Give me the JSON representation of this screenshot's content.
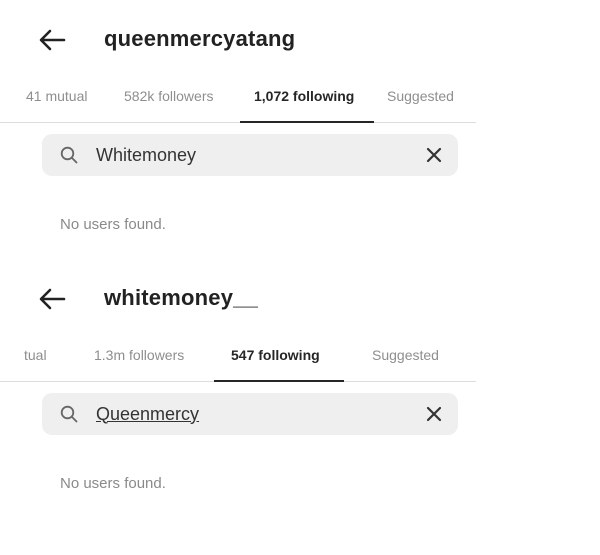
{
  "panels": [
    {
      "username": "queenmercyatang",
      "tabs": [
        {
          "label": "41 mutual",
          "active": false
        },
        {
          "label": "582k followers",
          "active": false
        },
        {
          "label": "1,072 following",
          "active": true
        },
        {
          "label": "Suggested",
          "active": false
        }
      ],
      "search": {
        "value": "Whitemoney",
        "placeholder": "Search"
      },
      "empty_message": "No users found."
    },
    {
      "username": "whitemoney__",
      "tabs": [
        {
          "label": "tual",
          "active": false
        },
        {
          "label": "1.3m followers",
          "active": false
        },
        {
          "label": "547 following",
          "active": true
        },
        {
          "label": "Suggested",
          "active": false
        }
      ],
      "search": {
        "value": "Queenmercy",
        "placeholder": "Search"
      },
      "empty_message": "No users found."
    }
  ],
  "icons": {
    "back": "arrow-left-icon",
    "search": "search-icon",
    "clear": "close-icon"
  },
  "colors": {
    "text_primary": "#222222",
    "text_muted": "#8e8e8e",
    "search_bg": "#efefef",
    "tab_indicator": "#262626"
  }
}
